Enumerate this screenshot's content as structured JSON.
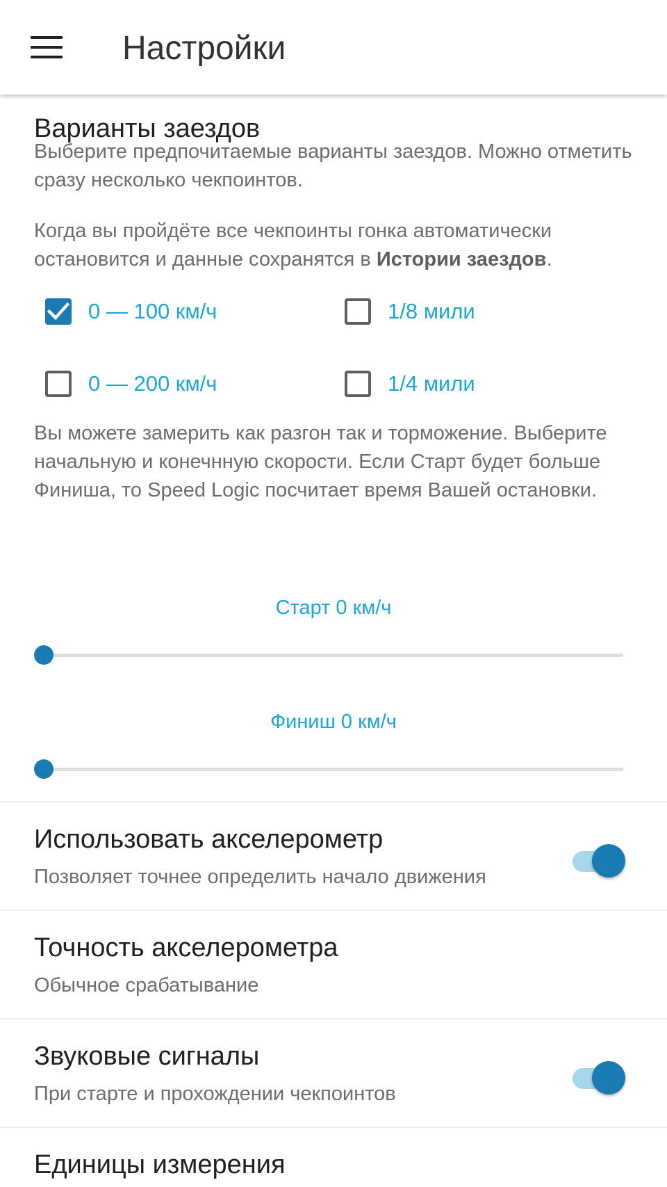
{
  "appbar": {
    "title": "Настройки",
    "menu_icon": "menu-icon"
  },
  "race_variants": {
    "title": "Варианты заездов",
    "description": "Выберите предпочитаемые варианты заездов. Можно отметить сразу несколько чекпоинтов.",
    "auto_stop_text_before": "Когда вы пройдёте все чекпоинты гонка автоматически остановится и данные сохранятся в ",
    "auto_stop_text_bold": "Истории заездов",
    "auto_stop_text_after": ".",
    "options": [
      {
        "label": "0 — 100 км/ч",
        "checked": true
      },
      {
        "label": "1/8 мили",
        "checked": false
      },
      {
        "label": "0 — 200 км/ч",
        "checked": false
      },
      {
        "label": "1/4 мили",
        "checked": false
      }
    ],
    "custom_text": "Вы можете замерить как разгон так и торможение. Выберите начальную и конечнную скорости. Если Старт будет больше Финиша, то Speed Logic посчитает время Вашей остановки.",
    "start_slider": {
      "label": "Старт 0 км/ч",
      "value": 0
    },
    "finish_slider": {
      "label": "Финиш 0 км/ч",
      "value": 0
    }
  },
  "preferences": [
    {
      "title": "Использовать акселерометр",
      "summary": "Позволяет точнее определить начало движения",
      "toggle": true
    },
    {
      "title": "Точность акселерометра",
      "summary": "Обычное срабатывание"
    },
    {
      "title": "Звуковые сигналы",
      "summary": "При старте и прохождении чекпоинтов",
      "toggle": true
    },
    {
      "title": "Единицы измерения"
    }
  ],
  "colors": {
    "accent": "#1a7bb3",
    "link_text": "#1ca6d6",
    "switch_track": "#a8d6ea"
  }
}
